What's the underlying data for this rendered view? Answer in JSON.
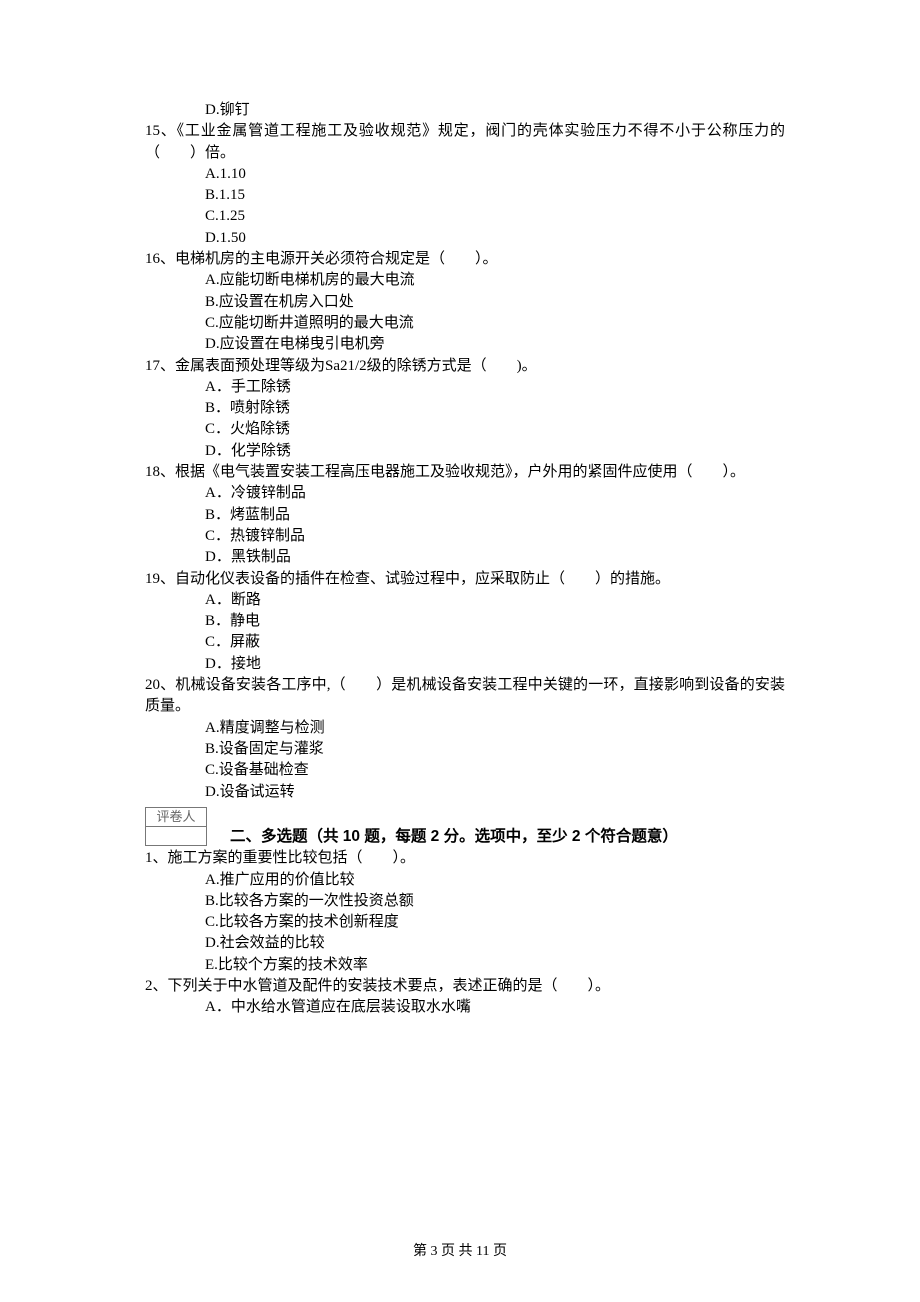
{
  "q14": {
    "options": {
      "d": "D.铆钉"
    }
  },
  "q15": {
    "text": "15、《工业金属管道工程施工及验收规范》规定，阀门的壳体实验压力不得不小于公称压力的（　　）倍。",
    "options": {
      "a": "A.1.10",
      "b": "B.1.15",
      "c": "C.1.25",
      "d": "D.1.50"
    }
  },
  "q16": {
    "text": "16、电梯机房的主电源开关必须符合规定是（　　）。",
    "options": {
      "a": "A.应能切断电梯机房的最大电流",
      "b": "B.应设置在机房入口处",
      "c": "C.应能切断井道照明的最大电流",
      "d": "D.应设置在电梯曳引电机旁"
    }
  },
  "q17": {
    "text": "17、金属表面预处理等级为Sa21/2级的除锈方式是（　　)。",
    "options": {
      "a": "A．手工除锈",
      "b": "B．喷射除锈",
      "c": "C．火焰除锈",
      "d": "D．化学除锈"
    }
  },
  "q18": {
    "text": "18、根据《电气装置安装工程高压电器施工及验收规范》，户外用的紧固件应使用（　　）。",
    "options": {
      "a": "A．冷镀锌制品",
      "b": "B．烤蓝制品",
      "c": "C．热镀锌制品",
      "d": "D．黑铁制品"
    }
  },
  "q19": {
    "text": "19、自动化仪表设备的插件在检查、试验过程中，应采取防止（　　）的措施。",
    "options": {
      "a": "A．断路",
      "b": "B．静电",
      "c": "C．屏蔽",
      "d": "D．接地"
    }
  },
  "q20": {
    "text": "20、机械设备安装各工序中,（　　）是机械设备安装工程中关键的一环，直接影响到设备的安装质量。",
    "options": {
      "a": "A.精度调整与检测",
      "b": "B.设备固定与灌浆",
      "c": "C.设备基础检查",
      "d": "D.设备试运转"
    }
  },
  "grader_label": "评卷人",
  "section2_title": "二、多选题（共 10 题，每题 2 分。选项中，至少 2 个符合题意）",
  "mq1": {
    "text": "1、施工方案的重要性比较包括（　　）。",
    "options": {
      "a": "A.推广应用的价值比较",
      "b": "B.比较各方案的一次性投资总额",
      "c": "C.比较各方案的技术创新程度",
      "d": "D.社会效益的比较",
      "e": "E.比较个方案的技术效率"
    }
  },
  "mq2": {
    "text": "2、下列关于中水管道及配件的安装技术要点，表述正确的是（　　）。",
    "options": {
      "a": "A．中水给水管道应在底层装设取水水嘴"
    }
  },
  "footer": "第 3 页 共 11 页"
}
